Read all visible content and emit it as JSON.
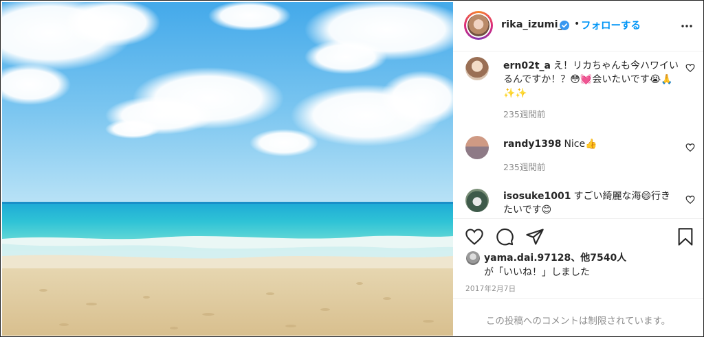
{
  "header": {
    "username": "rika_izumi_",
    "separator": "•",
    "follow_label": "フォローする",
    "more_icon": "more-horizontal-icon",
    "verified_icon": "verified-badge-icon"
  },
  "comments": [
    {
      "username": "ern02t_a",
      "text": "え！リカちゃんも今ハワイいるんですか！？😳💓会いたいです😭🙏✨✨",
      "time": "235週間前"
    },
    {
      "username": "randy1398",
      "text": "Nice👍",
      "time": "235週間前"
    },
    {
      "username": "isosuke1001",
      "text": "すごい綺麗な海😄行きたいです😊",
      "time": ""
    }
  ],
  "actions": {
    "like_icon": "heart-icon",
    "comment_icon": "comment-icon",
    "share_icon": "share-icon",
    "save_icon": "bookmark-icon"
  },
  "likes": {
    "line1": "yama.dai.97128、他7540人",
    "line2": "が「いいね！」しました"
  },
  "post_date": "2017年2月7日",
  "comment_box": {
    "disabled_text": "この投稿へのコメントは制限されています。"
  },
  "colors": {
    "accent": "#0095f6",
    "muted": "#8e8e8e",
    "text": "#262626"
  }
}
